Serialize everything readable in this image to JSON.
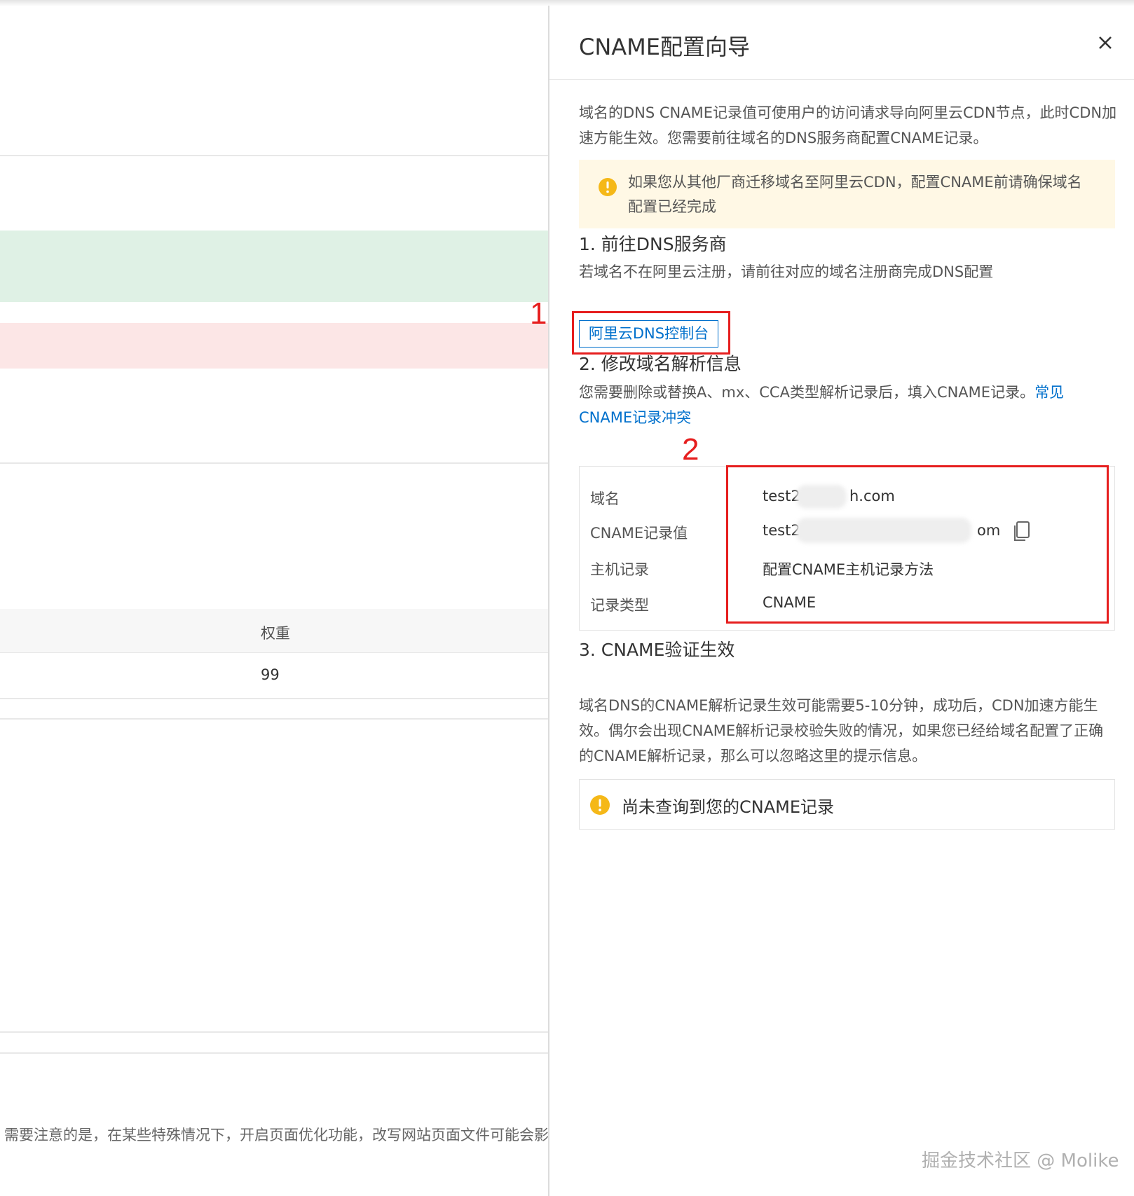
{
  "background": {
    "table_header_weight": "权重",
    "table_value_weight": "99",
    "bottom_note": "需要注意的是，在某些特殊情况下，开启页面优化功能，改写网站页面文件可能会影"
  },
  "drawer": {
    "title": "CNAME配置向导",
    "intro": "域名的DNS CNAME记录值可使用户的访问请求导向阿里云CDN节点，此时CDN加速方能生效。您需要前往域名的DNS服务商配置CNAME记录。",
    "warning": "如果您从其他厂商迁移域名至阿里云CDN，配置CNAME前请确保域名配置已经完成",
    "step1": {
      "heading": "1. 前往DNS服务商",
      "desc": "若域名不在阿里云注册，请前往对应的域名注册商完成DNS配置",
      "button": "阿里云DNS控制台"
    },
    "step2": {
      "heading": "2. 修改域名解析信息",
      "desc": "您需要删除或替换A、mx、CCA类型解析记录后，填入CNAME记录。",
      "link": "常见CNAME记录冲突",
      "rows": [
        {
          "label": "域名",
          "value_prefix": "test2",
          "value_suffix": "h.com"
        },
        {
          "label": "CNAME记录值",
          "value_prefix": "test2",
          "value_suffix": "om"
        },
        {
          "label": "主机记录",
          "value_link": "配置CNAME主机记录方法"
        },
        {
          "label": "记录类型",
          "value": "CNAME"
        }
      ]
    },
    "step3": {
      "heading": "3. CNAME验证生效",
      "desc": "域名DNS的CNAME解析记录生效可能需要5-10分钟，成功后，CDN加速方能生效。偶尔会出现CNAME解析记录校验失败的情况，如果您已经给域名配置了正确的CNAME解析记录，那么可以忽略这里的提示信息。",
      "status": "尚未查询到您的CNAME记录"
    }
  },
  "annotations": {
    "label1": "1",
    "label2": "2",
    "color": "#e61e1e"
  },
  "watermark": "掘金技术社区 @ Molike",
  "colors": {
    "link": "#0070cc",
    "warning_bg": "#fff8e5",
    "warning_icon": "#f5b818",
    "success_band": "#dff1e5",
    "error_band": "#fce6e6"
  }
}
